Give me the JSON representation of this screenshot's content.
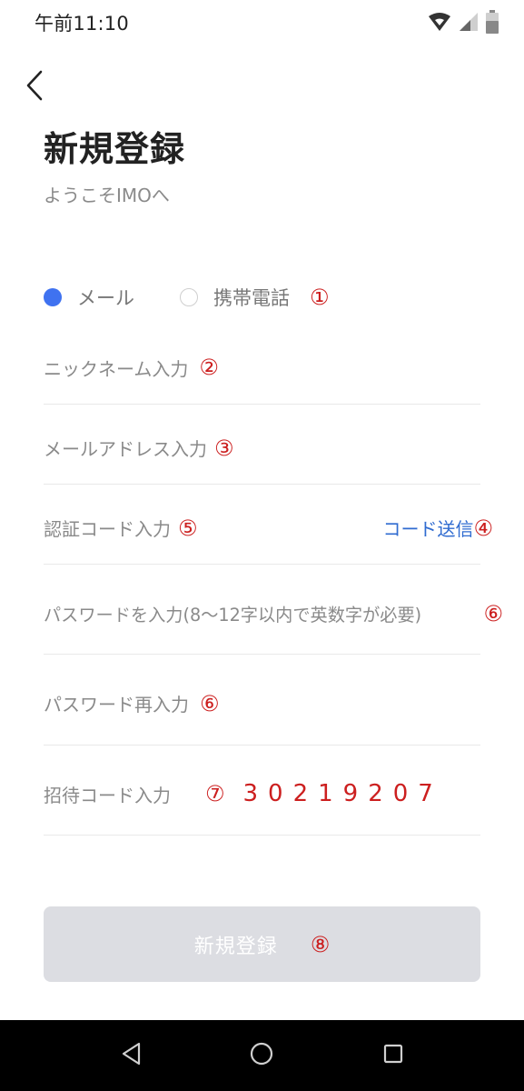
{
  "status_bar": {
    "time": "午前11:10",
    "icons": [
      "wifi-icon",
      "signal-icon",
      "battery-icon"
    ]
  },
  "header": {
    "back_icon": "back-arrow-icon",
    "title": "新規登録",
    "subtitle": "ようこそIMOへ"
  },
  "register_type": {
    "options": [
      {
        "label": "メール",
        "checked": true
      },
      {
        "label": "携帯電話",
        "checked": false
      }
    ],
    "note": "①"
  },
  "fields": [
    {
      "placeholder": "ニックネーム入力",
      "note": "②"
    },
    {
      "placeholder": "メールアドレス入力",
      "note": "③"
    },
    {
      "placeholder": "認証コード入力",
      "note": "⑤",
      "action_label": "コード送信",
      "action_note": "④"
    },
    {
      "placeholder": "パスワードを入力(8〜12字以内で英数字が必要)",
      "note": "⑥"
    },
    {
      "placeholder": "パスワード再入力",
      "note": "⑥"
    },
    {
      "placeholder": "招待コード入力",
      "note": "⑦",
      "value": "30219207"
    }
  ],
  "submit": {
    "label": "新規登録",
    "note": "⑧"
  },
  "nav_bar": {
    "icons": [
      "nav-back-icon",
      "nav-home-icon",
      "nav-recents-icon"
    ]
  },
  "colors": {
    "accent": "#3f72f0",
    "link": "#2f6bd0",
    "annotation": "#cc1f1f",
    "button_disabled": "#dcdde2"
  }
}
